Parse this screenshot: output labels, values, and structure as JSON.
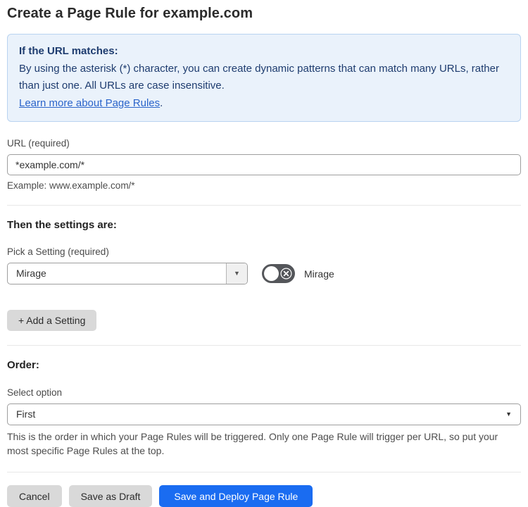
{
  "page": {
    "title": "Create a Page Rule for example.com"
  },
  "info_box": {
    "heading": "If the URL matches:",
    "body": "By using the asterisk (*) character, you can create dynamic patterns that can match many URLs, rather than just one. All URLs are case insensitive.",
    "link_text": "Learn more about Page Rules",
    "link_suffix": "."
  },
  "url_field": {
    "label": "URL (required)",
    "value": "*example.com/*",
    "helper": "Example: www.example.com/*"
  },
  "settings_section": {
    "heading": "Then the settings are:",
    "picker_label": "Pick a Setting (required)",
    "selected_setting": "Mirage",
    "toggle": {
      "label": "Mirage",
      "state": "off"
    },
    "add_button_label": "+ Add a Setting"
  },
  "order_section": {
    "heading": "Order:",
    "select_label": "Select option",
    "selected_option": "First",
    "helper": "This is the order in which your Page Rules will be triggered. Only one Page Rule will trigger per URL, so put your most specific Page Rules at the top."
  },
  "actions": {
    "cancel_label": "Cancel",
    "save_draft_label": "Save as Draft",
    "save_deploy_label": "Save and Deploy Page Rule"
  },
  "icons": {
    "dropdown_caret": "▼"
  },
  "colors": {
    "info_bg": "#eaf2fb",
    "info_border": "#b9d3f0",
    "info_text": "#1e3c6f",
    "link_blue": "#2a64ca",
    "primary_blue": "#1a6cf1",
    "toggle_off_gray": "#54565a",
    "button_gray": "#d9d9d9"
  }
}
